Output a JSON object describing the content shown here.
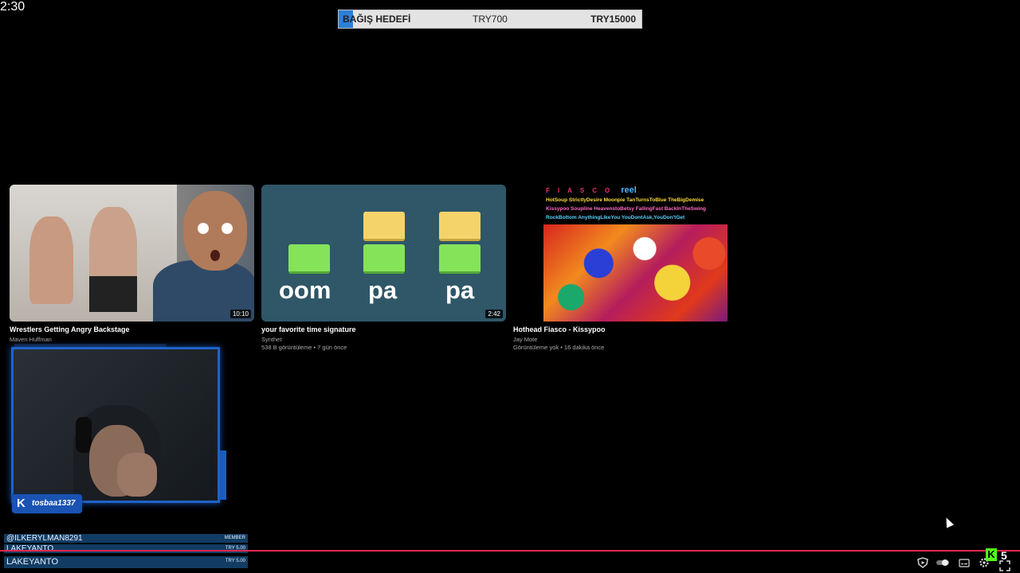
{
  "donation_goal": {
    "title": "BAĞIŞ HEDEFİ",
    "current": "TRY700",
    "target": "TRY15000",
    "progress_fraction": 0.047,
    "fill_color": "#2d7fd6"
  },
  "videos": [
    {
      "title": "Wrestlers Getting Angry Backstage",
      "channel": "Maven Huffman",
      "meta": "",
      "duration": "10:10"
    },
    {
      "title": "your favorite time signature",
      "channel": "Synthet",
      "meta": "538 B görüntüleme • 7 gün önce",
      "duration": "2:42",
      "thumb_words": [
        "oom",
        "pa",
        "pa"
      ]
    },
    {
      "title": "Hothead Fiasco - Kissypoo",
      "channel": "Jay Mote",
      "meta": "Görüntüleme yok • 16 dakika önce",
      "duration": "2:30",
      "art_logo": "FIASCO",
      "art_logo_suffix": "reel",
      "art_tracks": [
        "HotSoup StrictlyDesire Moonpie TanTurnsToBlue TheBigDemise",
        "Kissypoo Soupline HeavenstoBetsy FallingFast BackInTheSwing",
        "RockBottom AnythingLikeYou YouDontAsk,YouDon'tGet"
      ]
    }
  ],
  "webcam": {
    "streamer_name": "tosbaa1337",
    "platform_icon": "kick-icon",
    "frame_color": "#1e63c9"
  },
  "alerts": [
    {
      "name": "@ILKERYLMAN8291",
      "amount": "MEMBER"
    },
    {
      "name": "LAKEYANTO",
      "amount": "TRY 5.00"
    },
    {
      "name": "LAKEYANTO",
      "amount": "TRY 5.00"
    }
  ],
  "player": {
    "progress_color": "#e8274e",
    "viewer_count": "5",
    "icons": [
      "shield-play-icon",
      "toggle-icon",
      "captions-icon",
      "settings-icon",
      "fullscreen-icon"
    ]
  }
}
